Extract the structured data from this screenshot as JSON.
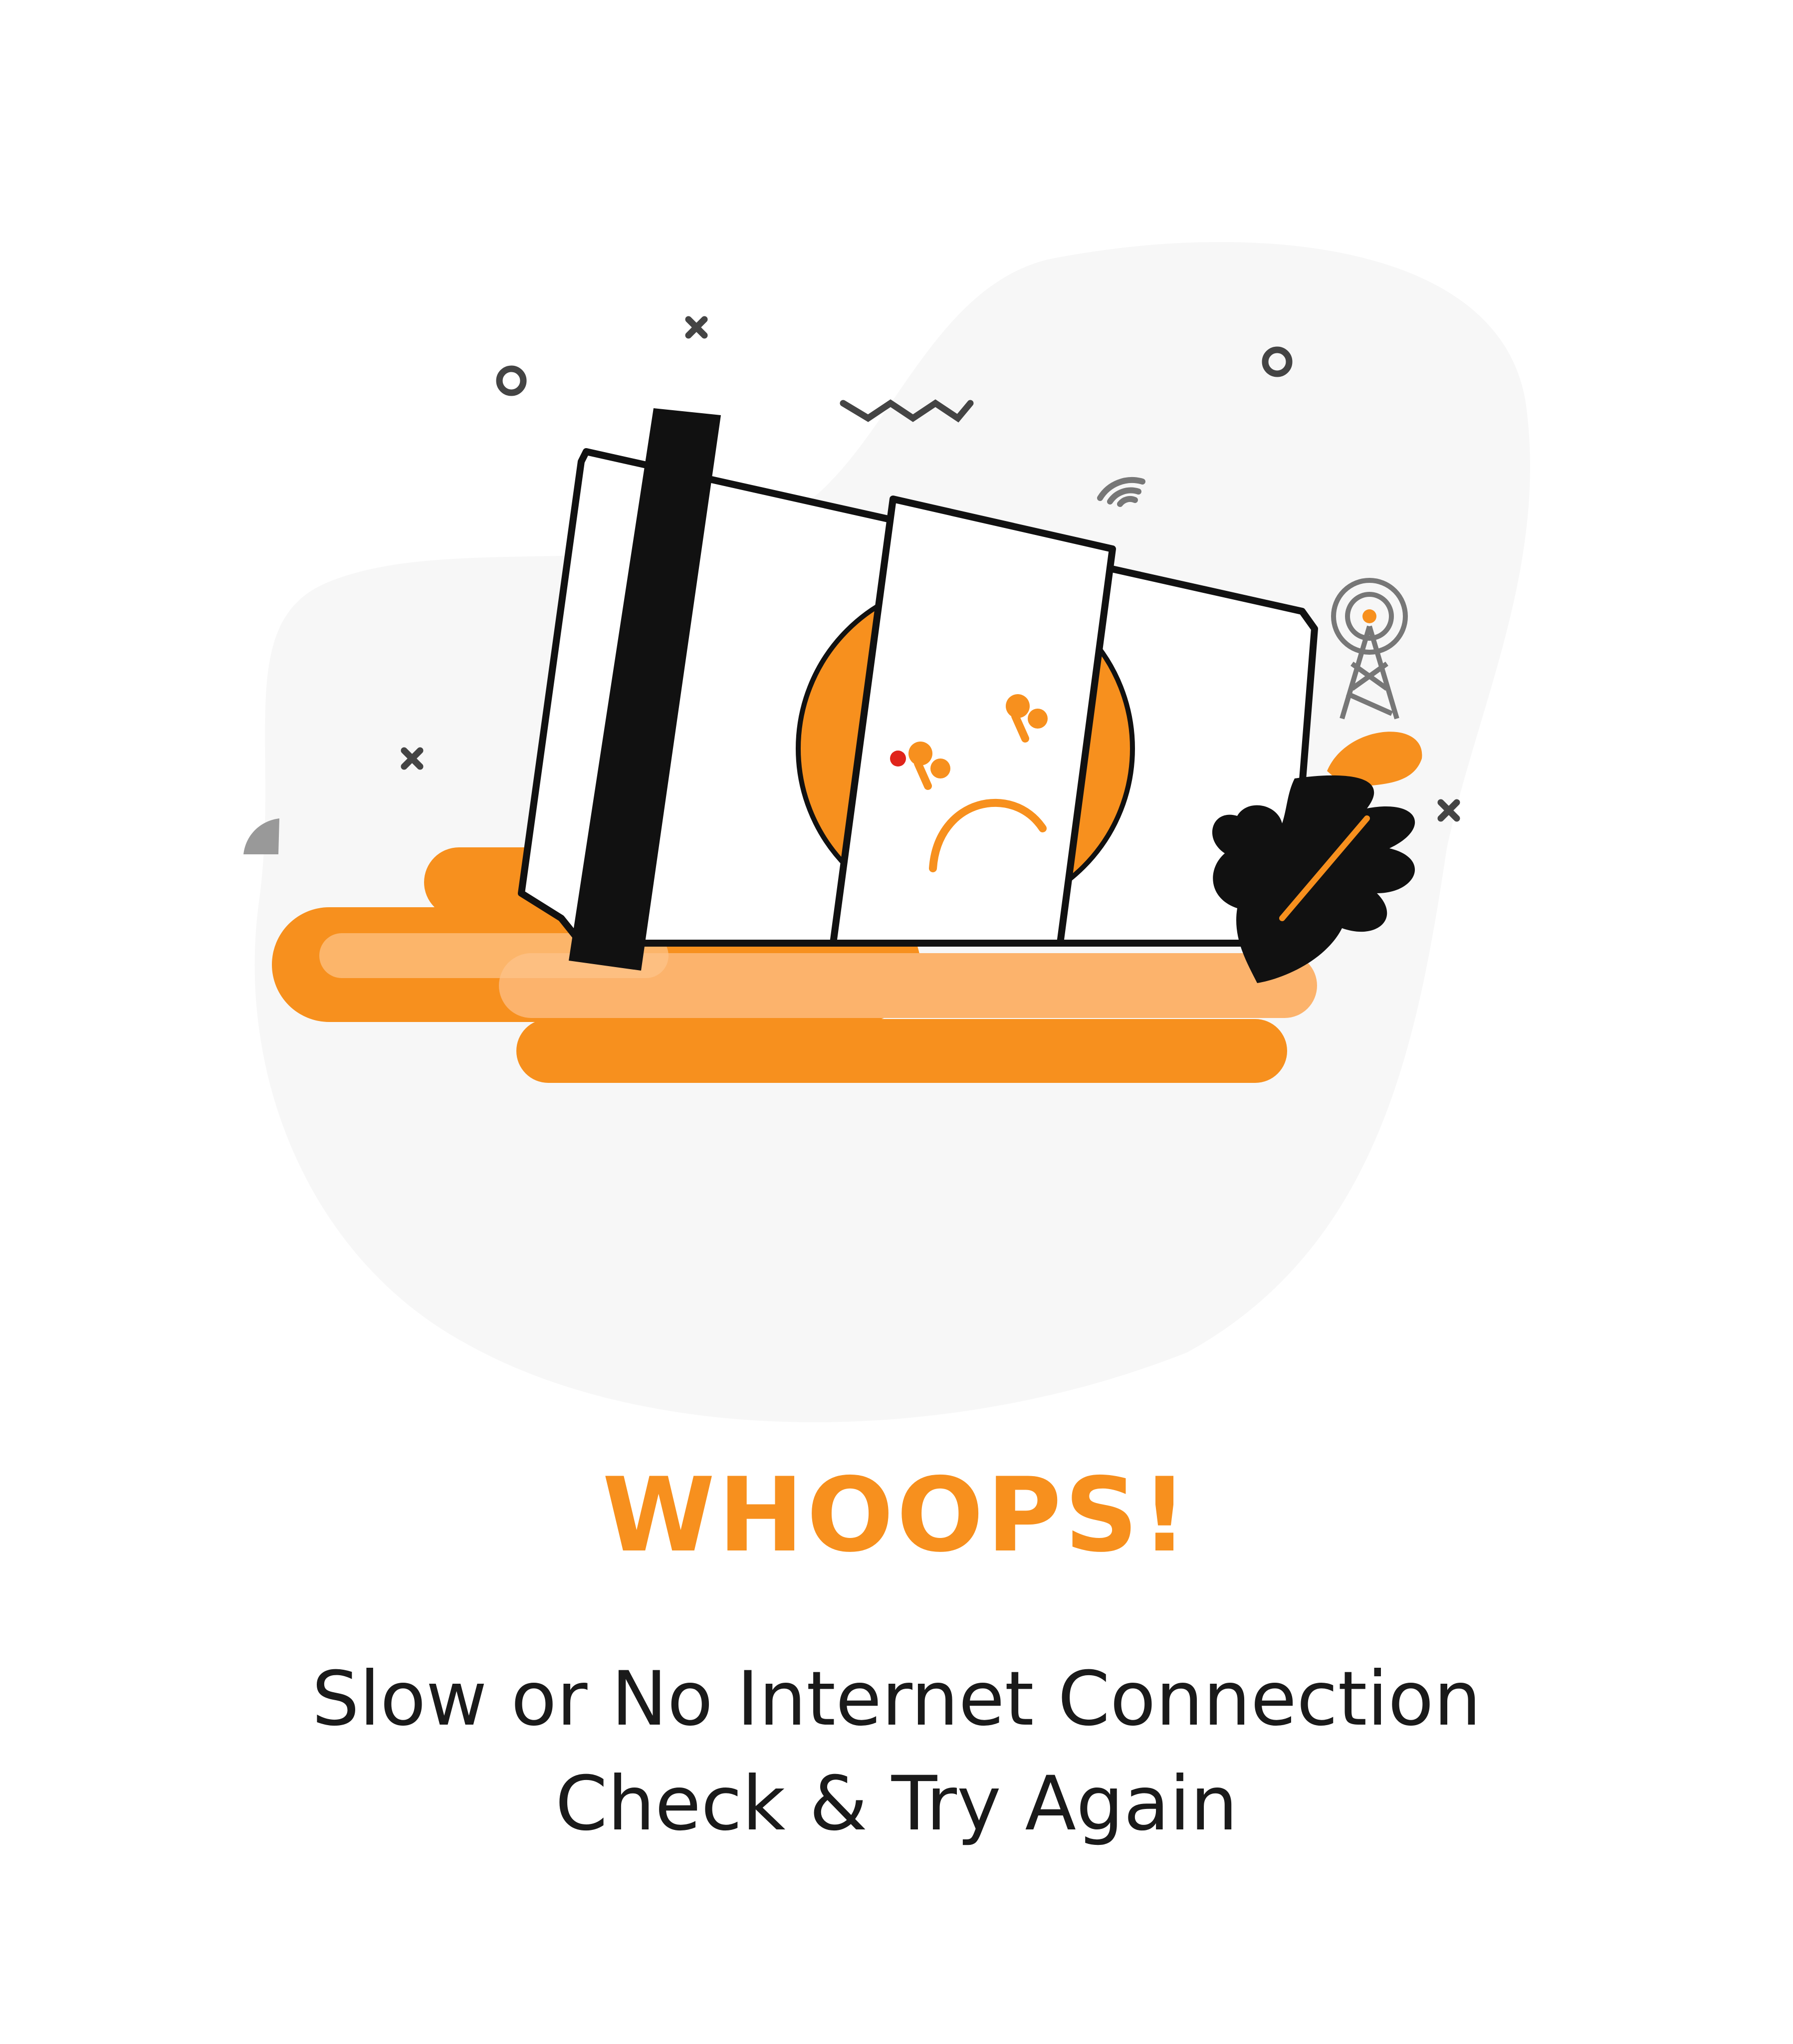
{
  "error": {
    "title": "WHOOPS!",
    "message_line1": "Slow or No Internet Connection",
    "message_line2": "Check & Try Again"
  },
  "illustration": {
    "subject": "toppled-coffee-cup-with-sad-face",
    "icons": [
      "wifi-icon",
      "signal-tower-icon",
      "leaf-icon",
      "spill-icon"
    ]
  },
  "colors": {
    "accent": "#f7901e",
    "spill_light": "#fcb36c",
    "outline": "#111111",
    "background_blob": "#f7f7f7",
    "text": "#1a1a1a"
  }
}
